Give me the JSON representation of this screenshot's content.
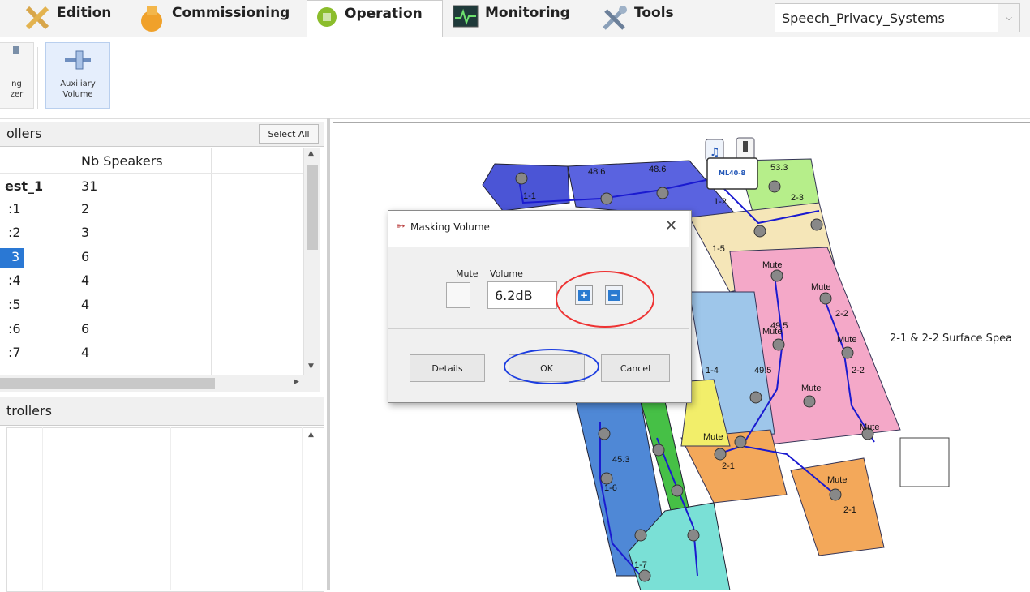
{
  "tabs": [
    {
      "label": "Edition",
      "icon": "edition-icon",
      "active": false
    },
    {
      "label": "Commissioning",
      "icon": "commissioning-icon",
      "active": false
    },
    {
      "label": "Operation",
      "icon": "operation-icon",
      "active": true
    },
    {
      "label": "Monitoring",
      "icon": "monitoring-icon",
      "active": false
    },
    {
      "label": "Tools",
      "icon": "tools-icon",
      "active": false
    }
  ],
  "project_select": {
    "value": "Speech_Privacy_Systems"
  },
  "ribbon": {
    "prev_button_label_line1": "ng",
    "prev_button_label_line2": "zer",
    "aux_label_line1": "Auxiliary",
    "aux_label_line2": "Volume"
  },
  "controllers_panel": {
    "title": "ollers",
    "select_all": "Select All",
    "column_header": "Nb Speakers",
    "rows": [
      {
        "name": "est_1",
        "speakers": "31",
        "selected": false,
        "bold": true
      },
      {
        "name": ":1",
        "speakers": "2",
        "selected": false,
        "bold": false
      },
      {
        "name": ":2",
        "speakers": "3",
        "selected": false,
        "bold": false
      },
      {
        "name": "3",
        "speakers": "6",
        "selected": true,
        "bold": false
      },
      {
        "name": ":4",
        "speakers": "4",
        "selected": false,
        "bold": false
      },
      {
        "name": ":5",
        "speakers": "4",
        "selected": false,
        "bold": false
      },
      {
        "name": ":6",
        "speakers": "6",
        "selected": false,
        "bold": false
      },
      {
        "name": ":7",
        "speakers": "4",
        "selected": false,
        "bold": false
      }
    ]
  },
  "controllers2_panel": {
    "title": "trollers"
  },
  "dialog": {
    "title": "Masking Volume",
    "mute_label": "Mute",
    "volume_label": "Volume",
    "volume_value": "6.2dB",
    "details": "Details",
    "ok": "OK",
    "cancel": "Cancel"
  },
  "plan": {
    "controller_label": "ML40-8",
    "annotation": "2-1 & 2-2 Surface Spea",
    "speaker_labels": [
      "48.6",
      "48.6",
      "53.3",
      "49.5",
      "49.5",
      "Mute",
      "Mute",
      "Mute",
      "Mute",
      "Mute",
      "Mute",
      "Mute",
      "Mute",
      "1-1",
      "1-2",
      "2-3",
      "2-2",
      "2-2",
      "2-1",
      "2-1",
      "1-5",
      "1-4",
      "1-6",
      "1-7",
      "45.3"
    ]
  },
  "colors": {
    "red_ring": "#e33333",
    "blue_ring": "#1c3de0",
    "selected_row": "#2a78d4"
  }
}
